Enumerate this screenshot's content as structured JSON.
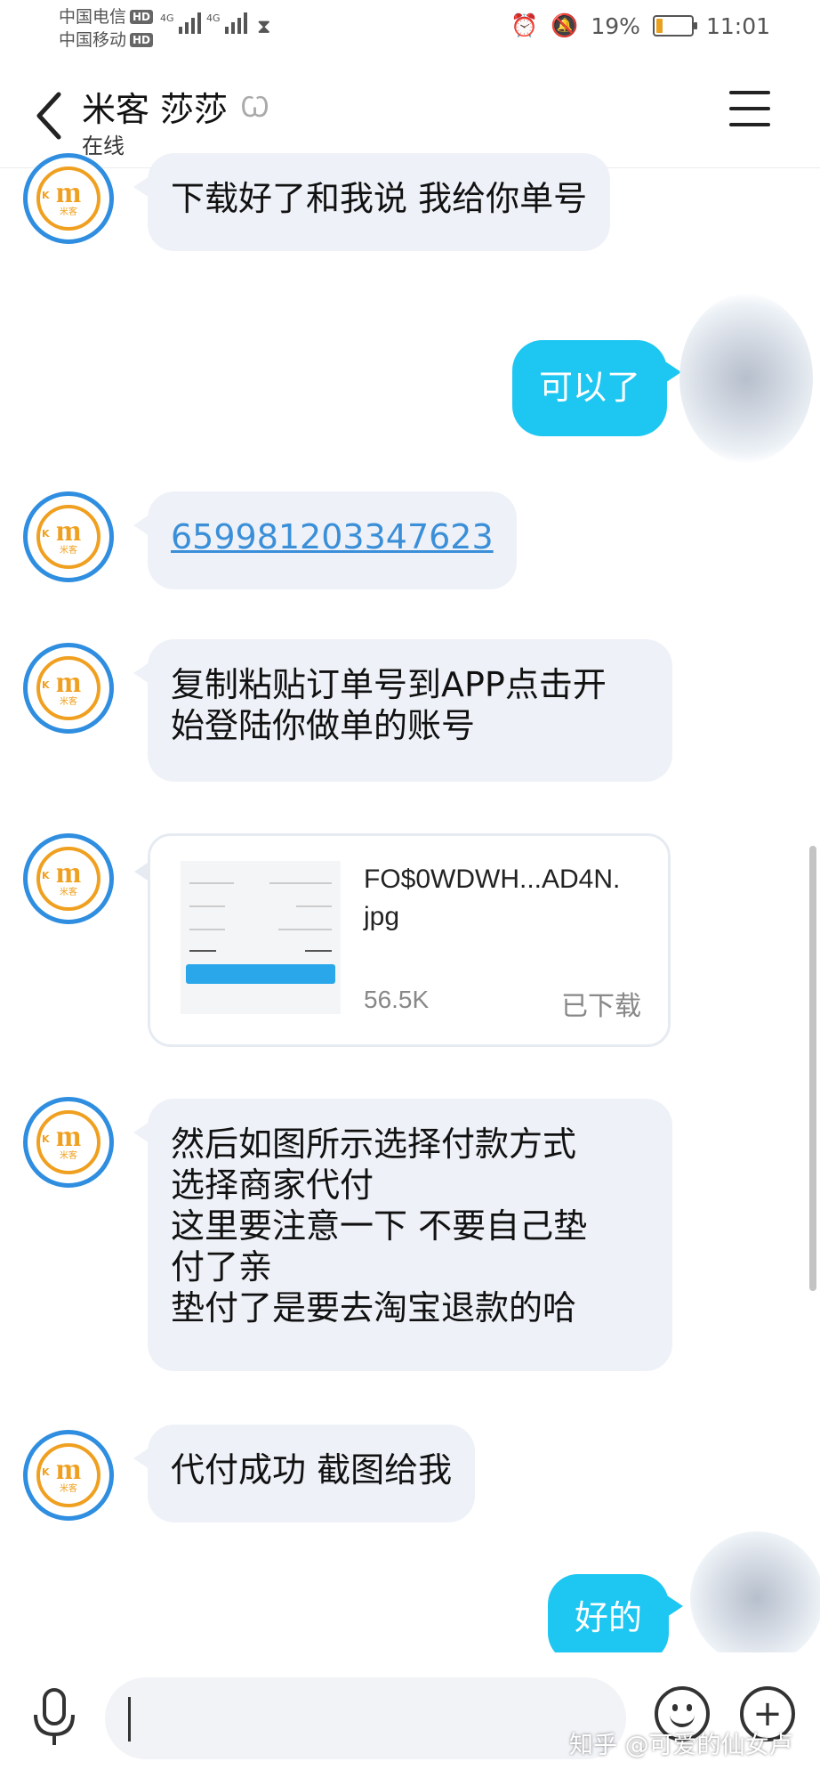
{
  "status_bar": {
    "carrier1": "中国电信",
    "carrier2": "中国移动",
    "hd_badge": "HD",
    "network1": "4G",
    "network2": "4G",
    "battery_percent": "19%",
    "battery_level": 0.19,
    "time": "11:01"
  },
  "header": {
    "title": "米客 莎莎",
    "subtitle": "在线"
  },
  "messages": [
    {
      "from": "other",
      "text": "下载好了和我说  我给你单号"
    },
    {
      "from": "me",
      "text": "可以了"
    },
    {
      "from": "other",
      "text": "659981203347623"
    },
    {
      "from": "other",
      "lines": [
        "复制粘贴订单号到APP点击开",
        "始登陆你做单的账号"
      ]
    },
    {
      "from": "other",
      "type": "file",
      "file_name_lines": [
        "FO$0WDWH...AD4N.",
        "jpg"
      ],
      "file_size": "56.5K",
      "file_status": "已下载"
    },
    {
      "from": "other",
      "lines": [
        "然后如图所示选择付款方式",
        "选择商家代付",
        "这里要注意一下  不要自己垫",
        "付了亲",
        "垫付了是要去淘宝退款的哈"
      ]
    },
    {
      "from": "other",
      "text": "代付成功  截图给我"
    },
    {
      "from": "me",
      "text": "好的"
    }
  ],
  "avatar": {
    "letter": "m",
    "side_letter": "K",
    "caption": "米客"
  },
  "watermark": "知乎 @可爱的仙女卢"
}
